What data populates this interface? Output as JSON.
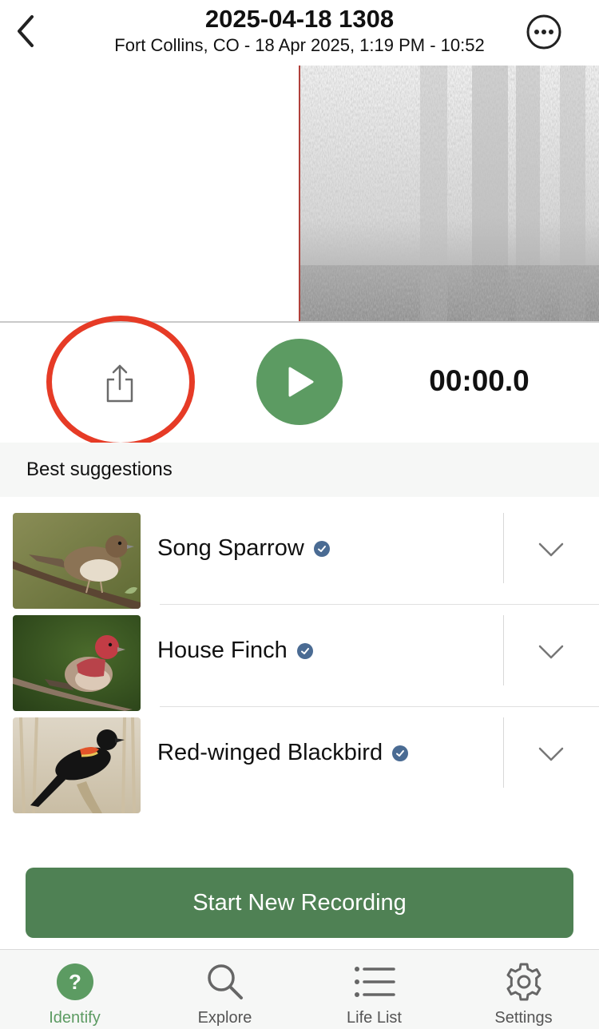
{
  "header": {
    "title": "2025-04-18 1308",
    "subtitle": "Fort Collins, CO - 18 Apr 2025, 1:19 PM - 10:52",
    "back_icon": "chevron-left-icon",
    "more_icon": "ellipsis-circle-icon"
  },
  "player": {
    "share_icon": "share-icon",
    "play_icon": "play-icon",
    "timer": "00:00.0",
    "accent_color": "#5c9b62",
    "highlight_color": "#e63b26"
  },
  "suggestions": {
    "header": "Best suggestions",
    "birds": [
      {
        "name": "Song Sparrow",
        "verified": true
      },
      {
        "name": "House Finch",
        "verified": true
      },
      {
        "name": "Red-winged Blackbird",
        "verified": true
      }
    ]
  },
  "start_button": {
    "label": "Start New Recording",
    "color": "#4f8154"
  },
  "tabbar": {
    "tabs": [
      {
        "label": "Identify",
        "icon": "question-circle-icon",
        "active": true
      },
      {
        "label": "Explore",
        "icon": "search-icon",
        "active": false
      },
      {
        "label": "Life List",
        "icon": "list-icon",
        "active": false
      },
      {
        "label": "Settings",
        "icon": "gear-icon",
        "active": false
      }
    ]
  }
}
